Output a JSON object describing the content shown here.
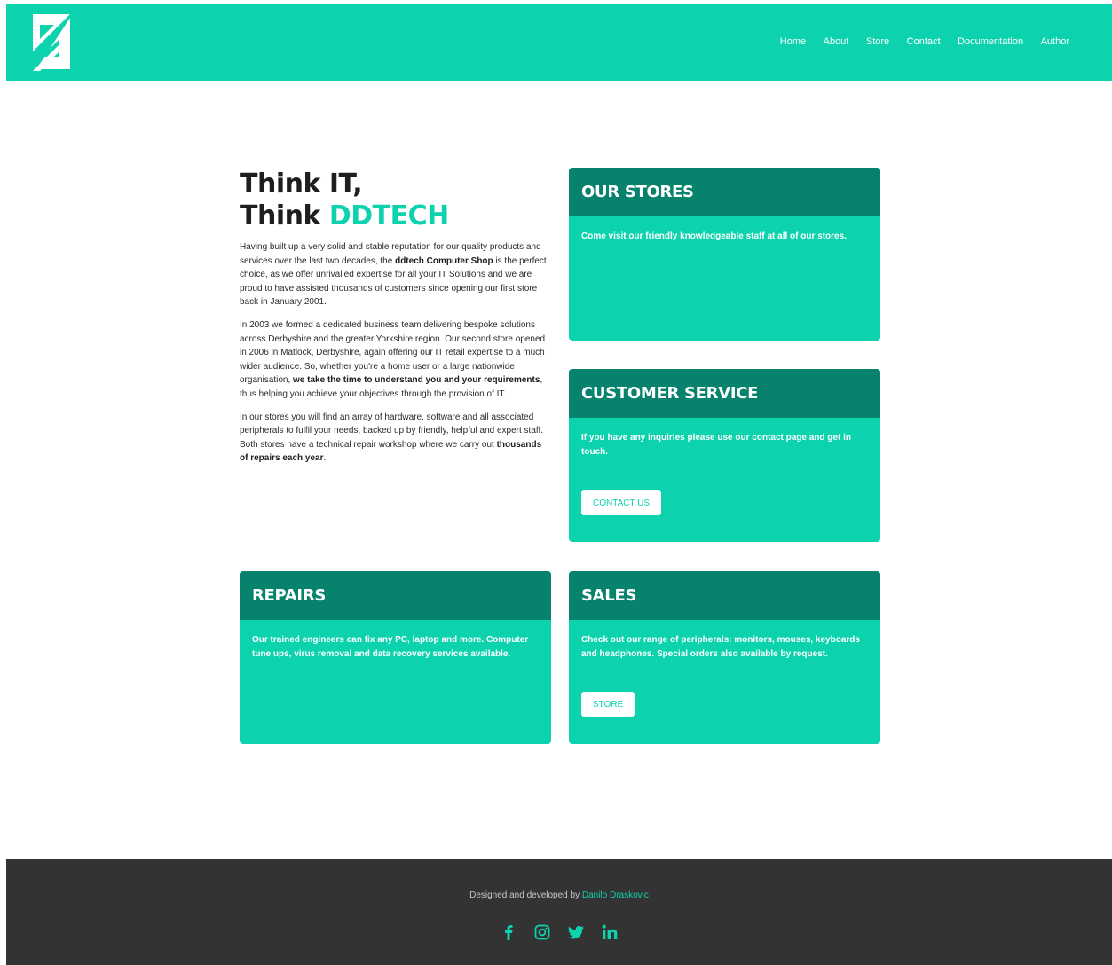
{
  "header": {
    "logo_icon": "ddtech-logo-icon",
    "nav": [
      "Home",
      "About",
      "Store",
      "Contact",
      "Documentation",
      "Author"
    ]
  },
  "intro": {
    "title_line1": "Think IT,",
    "title_line2_prefix": "Think",
    "title_line2_accent": "DDTECH",
    "p1_a": "Having built up a very solid and stable reputation for our quality products and services over the last two decades, the ",
    "p1_b": "ddtech Computer Shop",
    "p1_c": " is the perfect choice, as we offer unrivalled expertise for all your IT Solutions and we are proud to have assisted thousands of customers since opening our first store back in January 2001.",
    "p2_a": "In 2003 we formed a dedicated business team delivering bespoke solutions across Derbyshire and the greater Yorkshire region. Our second store opened in 2006 in Matlock, Derbyshire, again offering our IT retail expertise to a much wider audience. So, whether you're a home user or a large nationwide organisation, ",
    "p2_b": "we take the time to understand you and your requirements",
    "p2_c": ", thus helping you achieve your objectives through the provision of IT.",
    "p3_a": "In our stores you will find an array of hardware, software and all associated peripherals to fulfil your needs, backed up by friendly, helpful and expert staff. Both stores have a technical repair workshop where we carry out ",
    "p3_b": "thousands of repairs each year",
    "p3_c": "."
  },
  "cards": {
    "stores": {
      "title": "OUR STORES",
      "body": "Come visit our friendly knowledgeable staff at all of our stores."
    },
    "service": {
      "title": "CUSTOMER SERVICE",
      "body": "If you have any inquiries please use our contact page and get in touch.",
      "button": "CONTACT US"
    },
    "repairs": {
      "title": "REPAIRS",
      "body": "Our trained engineers can fix any PC, laptop and more. Computer tune ups, virus removal and data recovery services available."
    },
    "sales": {
      "title": "SALES",
      "body": "Check out our range of peripherals: monitors, mouses, keyboards and headphones. Special orders also available by request.",
      "button": "STORE"
    }
  },
  "footer": {
    "credit_prefix": "Designed and developed by ",
    "credit_author": "Danilo Draskovic",
    "socials": [
      "facebook-icon",
      "instagram-icon",
      "twitter-icon",
      "linkedin-icon"
    ]
  },
  "colors": {
    "brand": "#0cd3ae",
    "card_header": "#07836d",
    "footer_bg": "#333333"
  }
}
